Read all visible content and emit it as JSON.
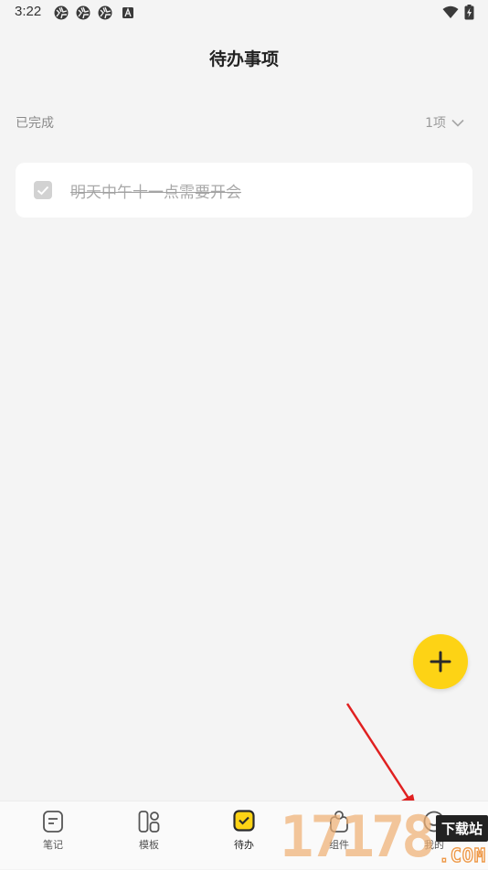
{
  "status_bar": {
    "time": "3:22",
    "icons": [
      "aperture-icon",
      "aperture-icon",
      "aperture-icon",
      "letter-a-icon",
      "wifi-icon",
      "battery-charging-icon"
    ]
  },
  "header": {
    "title": "待办事项"
  },
  "completed_section": {
    "label": "已完成",
    "count": "1项",
    "expand_icon": "chevron-down-icon"
  },
  "todos": [
    {
      "text": "明天中午十一点需要开会",
      "completed": true
    }
  ],
  "fab": {
    "icon": "plus-icon",
    "color": "#fdd315"
  },
  "bottom_nav": {
    "items": [
      {
        "label": "笔记",
        "icon": "note-icon",
        "active": false
      },
      {
        "label": "模板",
        "icon": "template-icon",
        "active": false
      },
      {
        "label": "待办",
        "icon": "todo-check-icon",
        "active": true
      },
      {
        "label": "组件",
        "icon": "widget-icon",
        "active": false
      },
      {
        "label": "我的",
        "icon": "profile-icon",
        "active": false
      }
    ]
  },
  "watermark": {
    "number": "17178",
    "badge": "下载站",
    "suffix": ".COM"
  },
  "colors": {
    "accent": "#fdd315",
    "background": "#f4f4f4",
    "card": "#ffffff",
    "annotation_arrow": "#e02020"
  }
}
